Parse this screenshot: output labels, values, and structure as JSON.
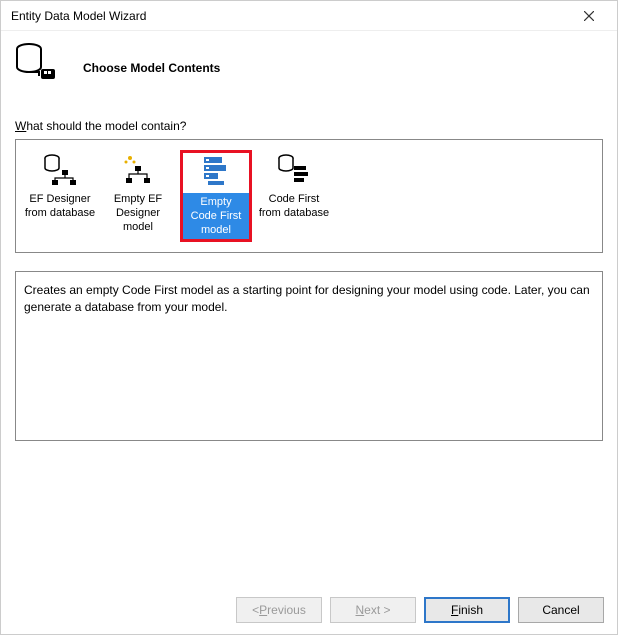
{
  "window": {
    "title": "Entity Data Model Wizard"
  },
  "header": {
    "title": "Choose Model Contents"
  },
  "prompt": {
    "mnemonic": "W",
    "rest": "hat should the model contain?"
  },
  "options": [
    {
      "label": "EF Designer from database"
    },
    {
      "label": "Empty EF Designer model"
    },
    {
      "label": "Empty Code First model"
    },
    {
      "label": "Code First from database"
    }
  ],
  "description": "Creates an empty Code First model as a starting point for designing your model using code. Later, you can generate a database from your model.",
  "buttons": {
    "previous_mnemonic": "P",
    "previous_rest": "revious",
    "next_mnemonic": "N",
    "next_rest": "ext >",
    "finish_mnemonic": "F",
    "finish_rest": "inish",
    "cancel": "Cancel"
  }
}
